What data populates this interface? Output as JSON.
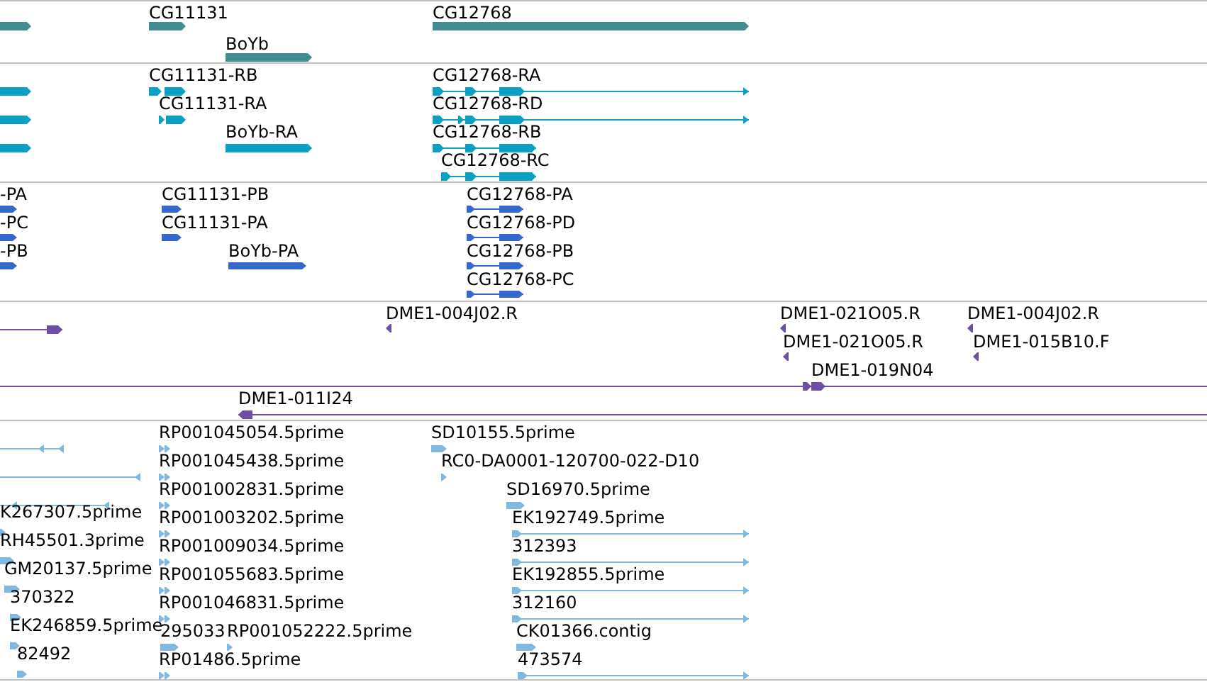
{
  "tracks": [
    {
      "kind": "gene",
      "color": "#408e91",
      "features": [
        {
          "reverse": false
        },
        {
          "label": "CG11131",
          "reverse": false
        },
        {
          "label": "BoYb",
          "reverse": false
        },
        {
          "label": "CG12768",
          "reverse": false
        }
      ]
    },
    {
      "kind": "transcript",
      "color": "#0aa0c4",
      "features": [
        {
          "reverse": false
        },
        {
          "reverse": false
        },
        {
          "reverse": false
        },
        {
          "label": "CG11131-RB",
          "reverse": false
        },
        {
          "label": "CG11131-RA",
          "reverse": false
        },
        {
          "label": "BoYb-RA",
          "reverse": false
        },
        {
          "label": "CG12768-RA",
          "reverse": false
        },
        {
          "label": "CG12768-RD",
          "reverse": false
        },
        {
          "label": "CG12768-RB",
          "reverse": false
        },
        {
          "label": "CG12768-RC",
          "reverse": false
        }
      ]
    },
    {
      "kind": "protein",
      "color": "#3468cc",
      "features": [
        {
          "label": "-PA",
          "reverse": false
        },
        {
          "label": "-PC",
          "reverse": false
        },
        {
          "label": "-PB",
          "reverse": false
        },
        {
          "label": "CG11131-PB",
          "reverse": false
        },
        {
          "label": "CG11131-PA",
          "reverse": false
        },
        {
          "label": "BoYb-PA",
          "reverse": false
        },
        {
          "label": "CG12768-PA",
          "reverse": false
        },
        {
          "label": "CG12768-PD",
          "reverse": false
        },
        {
          "label": "CG12768-PB",
          "reverse": false
        },
        {
          "label": "CG12768-PC",
          "reverse": false
        }
      ]
    },
    {
      "kind": "clone",
      "color": "#6f4fa6",
      "features": [
        {
          "reverse": false
        },
        {
          "label": "DME1-004J02.R",
          "reverse": true
        },
        {
          "label": "DME1-021O05.R",
          "reverse": true
        },
        {
          "label": "DME1-004J02.R",
          "reverse": true
        },
        {
          "label": "DME1-021O05.R",
          "reverse": true
        },
        {
          "label": "DME1-015B10.F",
          "reverse": true
        },
        {
          "label": "DME1-019N04",
          "reverse": false
        },
        {
          "label": "DME1-011I24",
          "reverse": true
        }
      ]
    },
    {
      "kind": "est",
      "color": "#80b8e0",
      "features": [
        {
          "reverse": true
        },
        {
          "reverse": true
        },
        {
          "reverse": true
        },
        {
          "label": "K267307.5prime",
          "reverse": false
        },
        {
          "label": "RH45501.3prime",
          "reverse": false
        },
        {
          "label": "GM20137.5prime",
          "reverse": false
        },
        {
          "label": "370322",
          "reverse": false
        },
        {
          "label": "EK246859.5prime",
          "reverse": false
        },
        {
          "label": "82492",
          "reverse": false
        },
        {
          "label": "RP001045054.5prime",
          "reverse": false
        },
        {
          "label": "RP001045438.5prime",
          "reverse": false
        },
        {
          "label": "RP001002831.5prime",
          "reverse": false
        },
        {
          "label": "RP001003202.5prime",
          "reverse": false
        },
        {
          "label": "RP001009034.5prime",
          "reverse": false
        },
        {
          "label": "RP001055683.5prime",
          "reverse": false
        },
        {
          "label": "RP001046831.5prime",
          "reverse": false
        },
        {
          "label": "295033",
          "reverse": false
        },
        {
          "label": "RP001052222.5prime",
          "reverse": false
        },
        {
          "label": "RP01486.5prime",
          "reverse": false
        },
        {
          "label": "SD10155.5prime",
          "reverse": false
        },
        {
          "label": "RC0-DA0001-120700-022-D10",
          "reverse": false
        },
        {
          "label": "SD16970.5prime",
          "reverse": false
        },
        {
          "label": "EK192749.5prime",
          "reverse": false
        },
        {
          "label": "312393",
          "reverse": false
        },
        {
          "label": "EK192855.5prime",
          "reverse": false
        },
        {
          "label": "312160",
          "reverse": false
        },
        {
          "label": "CK01366.contig",
          "reverse": false
        },
        {
          "label": "473574",
          "reverse": false
        }
      ]
    }
  ]
}
